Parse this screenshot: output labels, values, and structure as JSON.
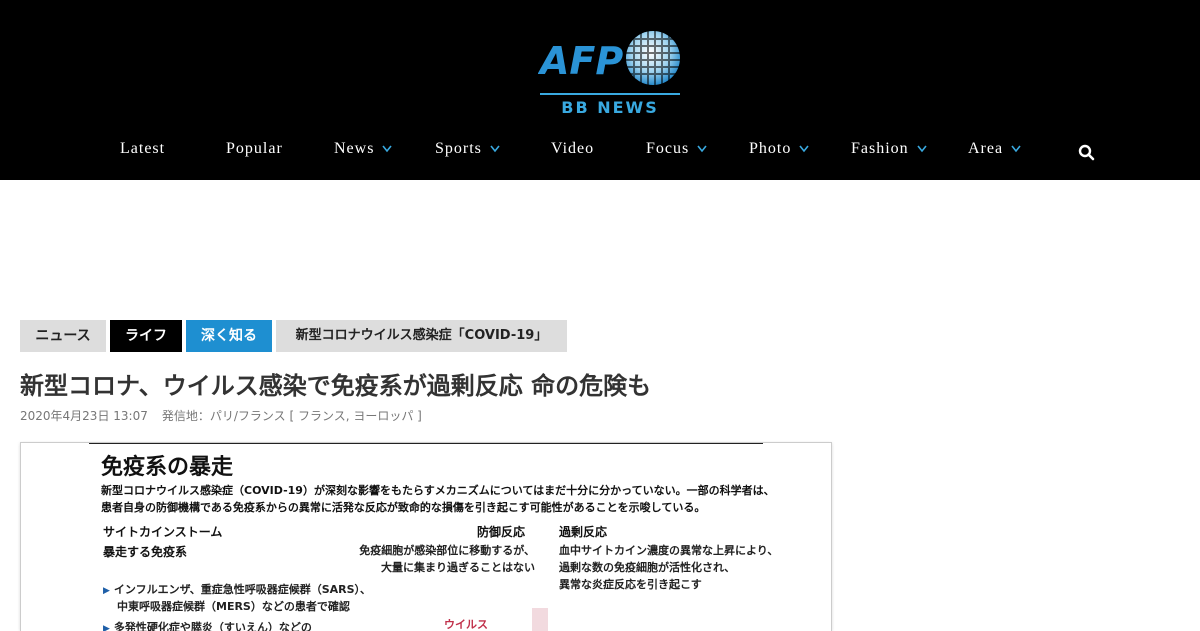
{
  "header": {
    "logo_label": "AFP",
    "logo_sub": "BB NEWS",
    "nav": [
      {
        "label": "Latest",
        "dropdown": false
      },
      {
        "label": "Popular",
        "dropdown": false
      },
      {
        "label": "News",
        "dropdown": true
      },
      {
        "label": "Sports",
        "dropdown": true
      },
      {
        "label": "Video",
        "dropdown": false
      },
      {
        "label": "Focus",
        "dropdown": true
      },
      {
        "label": "Photo",
        "dropdown": true
      },
      {
        "label": "Fashion",
        "dropdown": true
      },
      {
        "label": "Area",
        "dropdown": true
      }
    ],
    "search_icon": "search-icon",
    "accent_color": "#39a9e0"
  },
  "breadcrumbs": [
    {
      "label": "ニュース",
      "color": "#dddddd"
    },
    {
      "label": "ライフ",
      "color": "#000000"
    },
    {
      "label": "深く知る",
      "color": "#1e8fd1"
    },
    {
      "label": "新型コロナウイルス感染症「COVID-19」",
      "color": "#dddddd"
    }
  ],
  "article": {
    "title": "新型コロナ、ウイルス感染で免疫系が過剰反応 命の危険も",
    "date": "2020年4月23日 13:07",
    "dateline": "発信地：パリ/フランス [ フランス, ヨーロッパ ]"
  },
  "figure": {
    "heading": "免疫系の暴走",
    "intro_1": "新型コロナウイルス感染症（COVID-19）が深刻な影響をもたらすメカニズムについてはまだ十分に分かっていない。一部の科学者は、",
    "intro_2": "患者自身の防御機構である免疫系からの異常に活発な反応が致命的な損傷を引き起こす可能性があることを示唆している。",
    "col1_title": "サイトカインストーム",
    "col1_sub": "暴走する免疫系",
    "col1_item1a": "インフルエンザ、重症急性呼吸器症候群（SARS）、",
    "col1_item1b": "中東呼吸器症候群（MERS）などの患者で確認",
    "col1_item2": "多発性硬化症や膵炎（すいえん）などの",
    "col2_title": "防御反応",
    "col2_line1": "免疫細胞が感染部位に移動するが、",
    "col2_line2": "大量に集まり過ぎることはない",
    "col3_title": "過剰反応",
    "col3_line1": "血中サイトカイン濃度の異常な上昇により、",
    "col3_line2": "過剰な数の免疫細胞が活性化され、",
    "col3_line3": "異常な炎症反応を引き起こす",
    "virus_label": "ウイルス"
  }
}
